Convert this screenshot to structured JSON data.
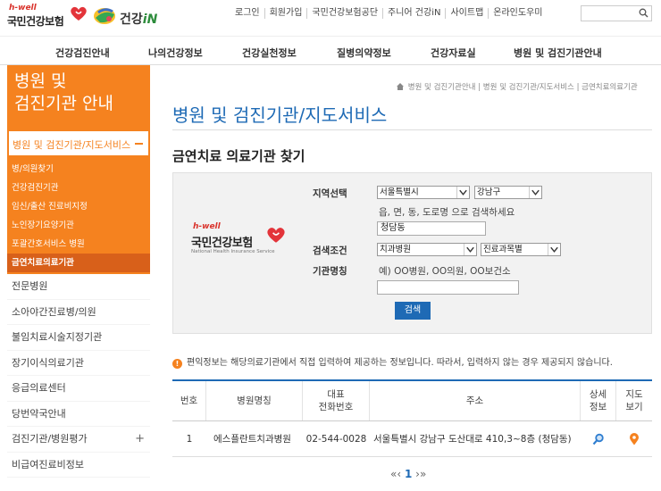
{
  "header": {
    "logo_hwell": "h-well",
    "logo_nhis": "국민건강보험",
    "logo_gunkang_prefix": "건강",
    "logo_gunkang_suffix": "iN",
    "top_links": [
      "로그인",
      "회원가입",
      "국민건강보험공단",
      "주니어 건강iN",
      "사이트맵",
      "온라인도우미"
    ],
    "search_placeholder": ""
  },
  "main_nav": [
    "건강검진안내",
    "나의건강정보",
    "건강실천정보",
    "질병의약정보",
    "건강자료실",
    "병원 및 검진기관안내"
  ],
  "sidebar": {
    "title_line1": "병원 및",
    "title_line2": "검진기관 안내",
    "active_section": "병원 및 검진기관/지도서비스",
    "sub_items": [
      "병/의원찾기",
      "건강검진기관",
      "임신/출산 진료비지정",
      "노인장기요양기관",
      "포괄간호서비스 병원",
      "금연치료의료기관"
    ],
    "items": [
      "전문병원",
      "소아야간진료병/의원",
      "불임치료시술지정기관",
      "장기이식의료기관",
      "응급의료센터",
      "당번약국안내",
      "검진기관/병원평가",
      "비급여진료비정보"
    ],
    "expand_symbol": "+"
  },
  "breadcrumb": "병원 및 검진기관안내 | 병원 및 검진기관/지도서비스 | 금연치료의료기관",
  "page_title": "병원 및 검진기관/지도서비스",
  "section_title": "금연치료 의료기관 찾기",
  "search_form": {
    "panel_logo_hwell": "h-well",
    "panel_logo_name": "국민건강보험",
    "panel_logo_sub": "National Health Insurance Service",
    "region_label": "지역선택",
    "region_city": "서울특별시",
    "region_district": "강남구",
    "address_help": "읍, 면, 동, 도로명 으로 검색하세요",
    "address_value": "청담동",
    "condition_label": "검색조건",
    "condition_type": "치과병원",
    "condition_dept": "진료과목별",
    "institution_label": "기관명칭",
    "institution_help": "예) OO병원, OO의원, OO보건소",
    "institution_value": "",
    "search_button": "검색"
  },
  "notice": "편익정보는 해당의료기관에서 직접 입력하여 제공하는 정보입니다. 따라서, 입력하지 않는 경우 제공되지 않습니다.",
  "table": {
    "headers": [
      "번호",
      "병원명칭",
      "대표\n전화번호",
      "주소",
      "상세\n정보",
      "지도\n보기"
    ],
    "rows": [
      {
        "no": "1",
        "name": "에스플란트치과병원",
        "phone": "02-544-0028",
        "address": "서울특별시 강남구 도산대로 410,3~8층 (청담동)"
      }
    ]
  },
  "pager": {
    "first": "«",
    "prev": "‹",
    "current": "1",
    "next": "›",
    "last": "»"
  },
  "colors": {
    "accent_orange": "#f5821f",
    "brand_blue": "#1e6ab5"
  }
}
